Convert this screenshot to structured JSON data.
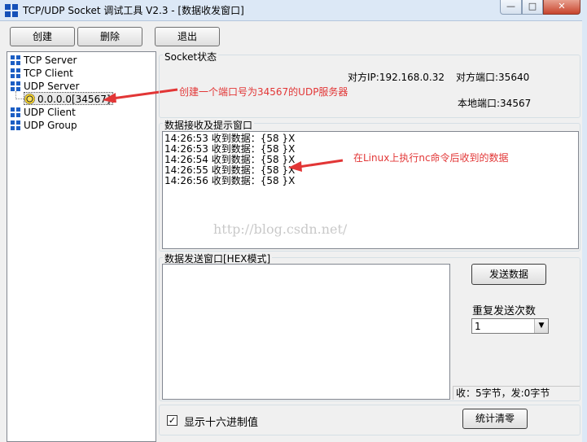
{
  "window": {
    "title": "TCP/UDP Socket 调试工具 V2.3 - [数据收发窗口]",
    "min_glyph": "—",
    "max_glyph": "□",
    "close_glyph": "✕"
  },
  "toolbar": {
    "create_label": "创建",
    "delete_label": "删除",
    "exit_label": "退出"
  },
  "tree": {
    "tcp_server": "TCP Server",
    "tcp_client": "TCP Client",
    "udp_server": "UDP Server",
    "udp_server_child": "0.0.0.0[34567]",
    "udp_client": "UDP Client",
    "udp_group": "UDP Group"
  },
  "socket_status": {
    "group_label": "Socket状态",
    "remote_ip": "对方IP:192.168.0.32",
    "remote_port": "对方端口:35640",
    "local_port": "本地端口:34567"
  },
  "receive": {
    "group_label": "数据接收及提示窗口",
    "lines": [
      "14:26:53 收到数据：{58 }X",
      "14:26:53 收到数据：{58 }X",
      "14:26:54 收到数据：{58 }X",
      "14:26:55 收到数据：{58 }X",
      "14:26:56 收到数据：{58 }X"
    ],
    "watermark": "http://blog.csdn.net/"
  },
  "send": {
    "group_label": "数据发送窗口[HEX模式]",
    "send_button": "发送数据",
    "repeat_label": "重复发送次数",
    "repeat_value": "1",
    "stats": "收：5字节，发:0字节"
  },
  "footer": {
    "hex_checkbox_label": "显示十六进制值",
    "hex_checked_glyph": "✓",
    "reset_stats_button": "统计清零"
  },
  "annotations": {
    "udp_server_note": "创建一个端口号为34567的UDP服务器",
    "linux_note": "在Linux上执行nc命令后收到的数据"
  },
  "colors": {
    "annotation": "#e23636",
    "tree_icon": "#1c5ec4",
    "title_bar": "#dce8f6"
  }
}
